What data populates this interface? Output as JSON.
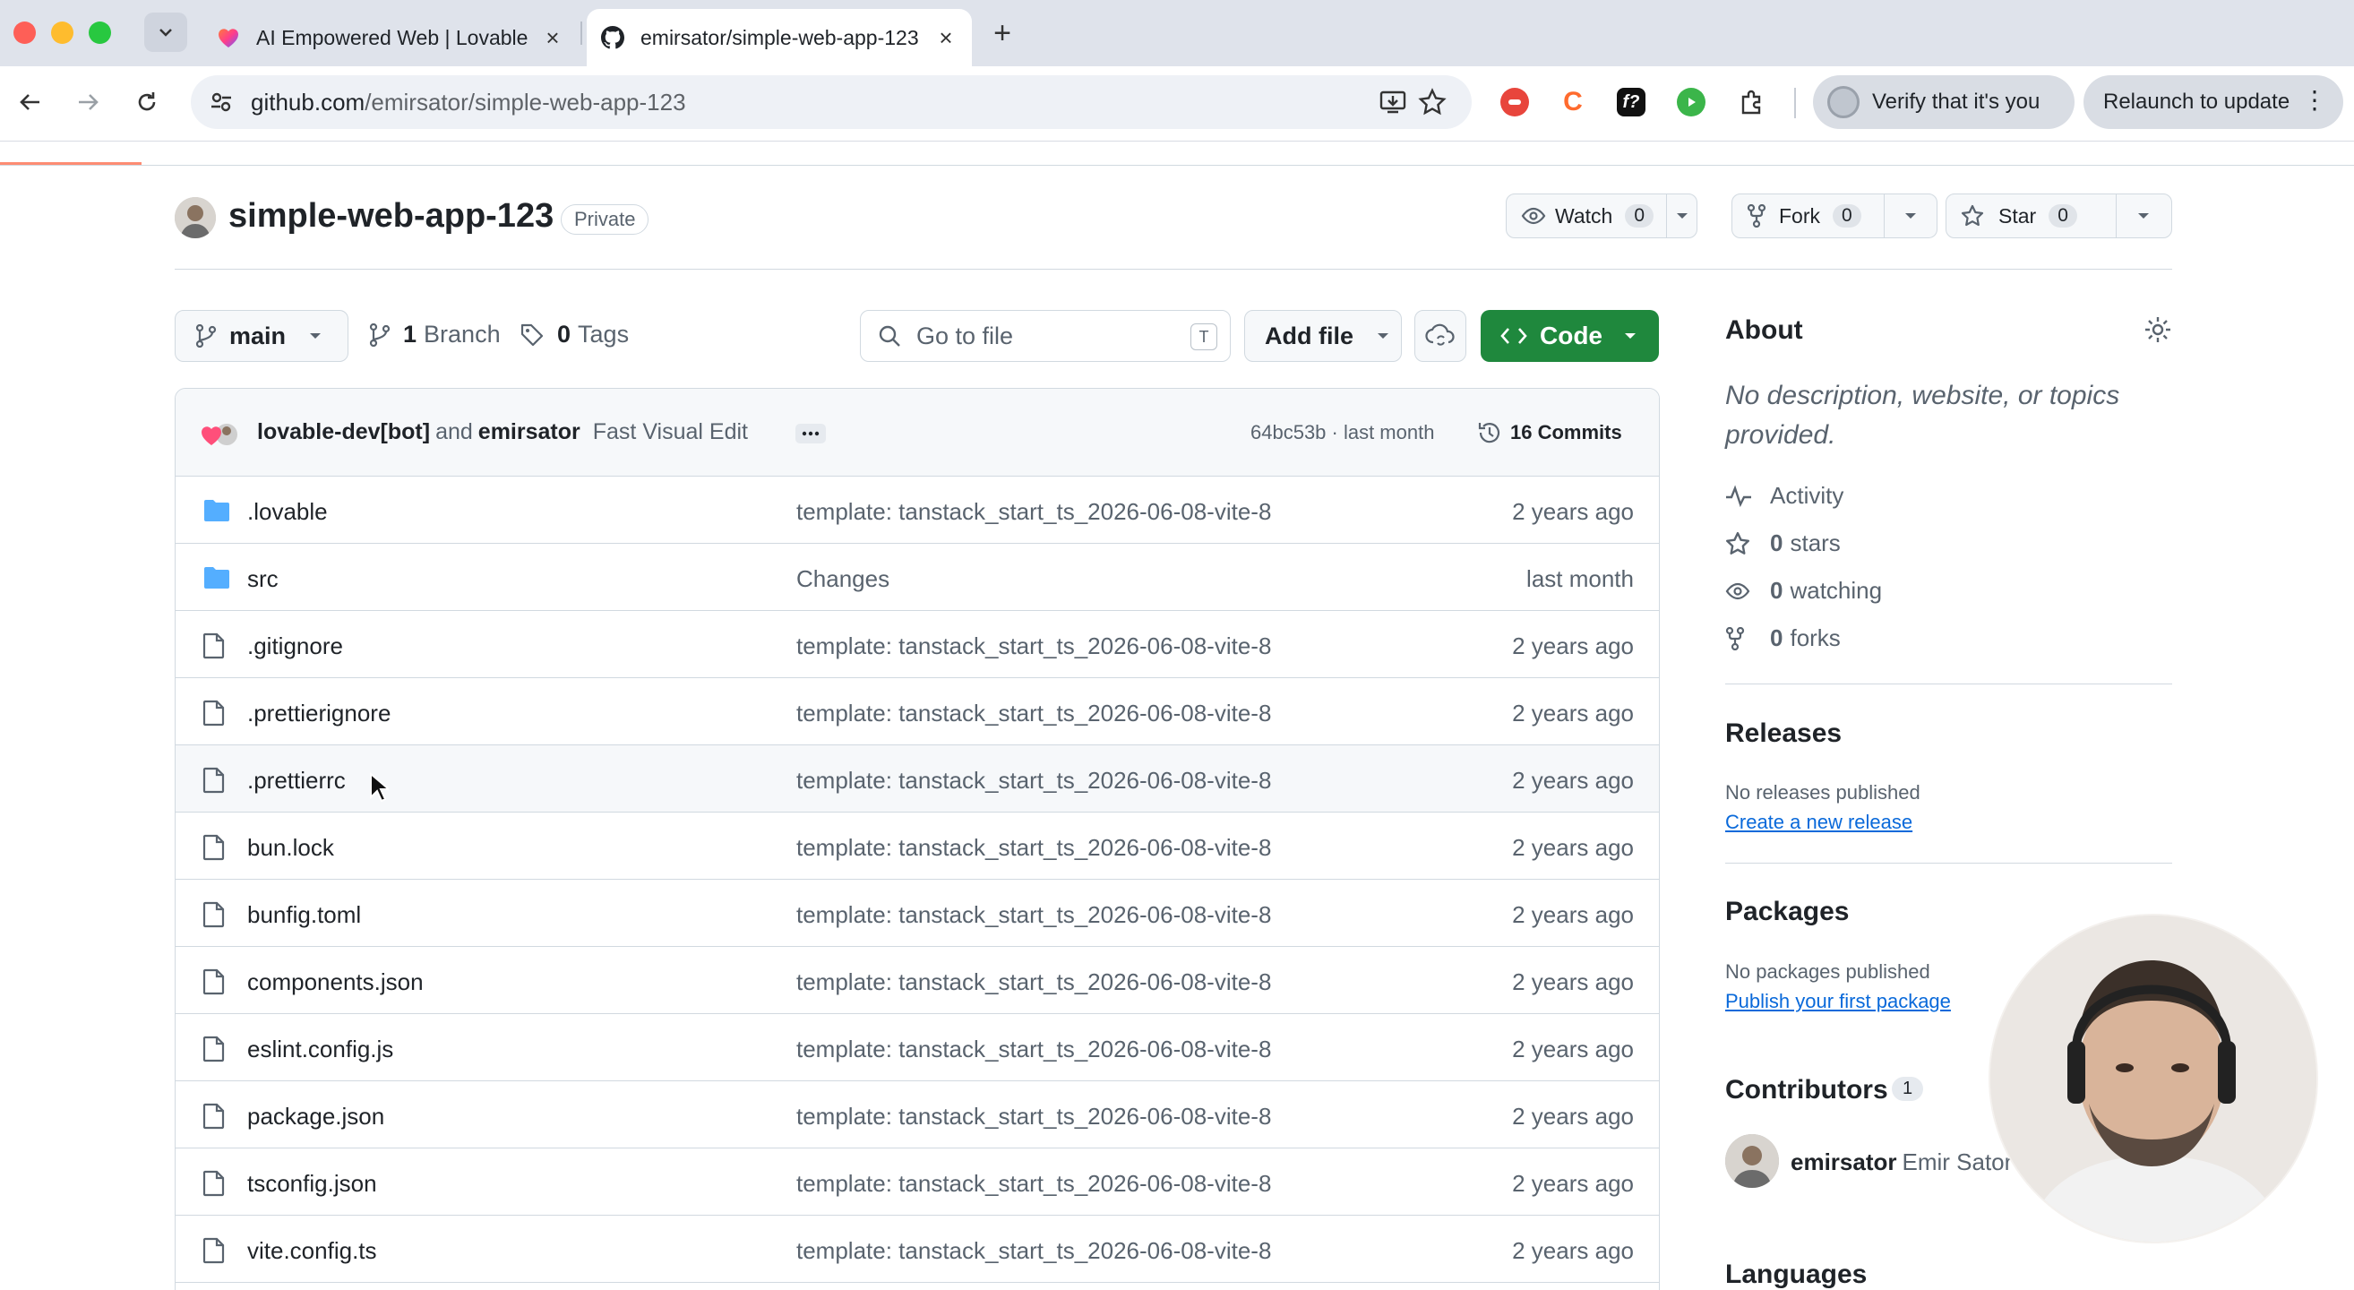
{
  "browser": {
    "tabs": [
      {
        "title": "AI Empowered Web | Lovable",
        "active": false
      },
      {
        "title": "emirsator/simple-web-app-123",
        "active": true
      }
    ],
    "url_host": "github.com",
    "url_path": "/emirsator/simple-web-app-123",
    "verify_label": "Verify that it's you",
    "relaunch_label": "Relaunch to update"
  },
  "repo": {
    "name": "simple-web-app-123",
    "visibility": "Private",
    "watch_label": "Watch",
    "watch_count": "0",
    "fork_label": "Fork",
    "fork_count": "0",
    "star_label": "Star",
    "star_count": "0"
  },
  "filenav": {
    "branch": "main",
    "branch_count": "1",
    "branch_label": "Branch",
    "tag_count": "0",
    "tag_label": "Tags",
    "goto_placeholder": "Go to file",
    "goto_shortcut": "T",
    "add_file_label": "Add file",
    "code_label": "Code"
  },
  "commit": {
    "author1": "lovable-dev[bot]",
    "joiner": "and",
    "author2": "emirsator",
    "message": "Fast Visual Edit",
    "hash_age": "64bc53b · last month",
    "commits_label": "16 Commits"
  },
  "files": [
    {
      "name": ".lovable",
      "type": "folder",
      "message": "template: tanstack_start_ts_2026-06-08-vite-8",
      "age": "2 years ago"
    },
    {
      "name": "src",
      "type": "folder",
      "message": "Changes",
      "age": "last month"
    },
    {
      "name": ".gitignore",
      "type": "file",
      "message": "template: tanstack_start_ts_2026-06-08-vite-8",
      "age": "2 years ago"
    },
    {
      "name": ".prettierignore",
      "type": "file",
      "message": "template: tanstack_start_ts_2026-06-08-vite-8",
      "age": "2 years ago"
    },
    {
      "name": ".prettierrc",
      "type": "file",
      "message": "template: tanstack_start_ts_2026-06-08-vite-8",
      "age": "2 years ago"
    },
    {
      "name": "bun.lock",
      "type": "file",
      "message": "template: tanstack_start_ts_2026-06-08-vite-8",
      "age": "2 years ago"
    },
    {
      "name": "bunfig.toml",
      "type": "file",
      "message": "template: tanstack_start_ts_2026-06-08-vite-8",
      "age": "2 years ago"
    },
    {
      "name": "components.json",
      "type": "file",
      "message": "template: tanstack_start_ts_2026-06-08-vite-8",
      "age": "2 years ago"
    },
    {
      "name": "eslint.config.js",
      "type": "file",
      "message": "template: tanstack_start_ts_2026-06-08-vite-8",
      "age": "2 years ago"
    },
    {
      "name": "package.json",
      "type": "file",
      "message": "template: tanstack_start_ts_2026-06-08-vite-8",
      "age": "2 years ago"
    },
    {
      "name": "tsconfig.json",
      "type": "file",
      "message": "template: tanstack_start_ts_2026-06-08-vite-8",
      "age": "2 years ago"
    },
    {
      "name": "vite.config.ts",
      "type": "file",
      "message": "template: tanstack_start_ts_2026-06-08-vite-8",
      "age": "2 years ago"
    }
  ],
  "sidebar": {
    "about_title": "About",
    "description": "No description, website, or topics provided.",
    "activity": "Activity",
    "stars_count": "0",
    "stars_label": "stars",
    "watching_count": "0",
    "watching_label": "watching",
    "forks_count": "0",
    "forks_label": "forks",
    "releases_title": "Releases",
    "releases_empty": "No releases published",
    "releases_link": "Create a new release",
    "packages_title": "Packages",
    "packages_empty": "No packages published",
    "packages_link": "Publish your first package",
    "contributors_title": "Contributors",
    "contributors_count": "1",
    "contributor_login": "emirsator",
    "contributor_name": "Emir Sator",
    "languages_title": "Languages"
  },
  "icons": {
    "folder_color": "#54aeff",
    "file_color": "#59636e",
    "code_button_color": "#1f883d"
  }
}
